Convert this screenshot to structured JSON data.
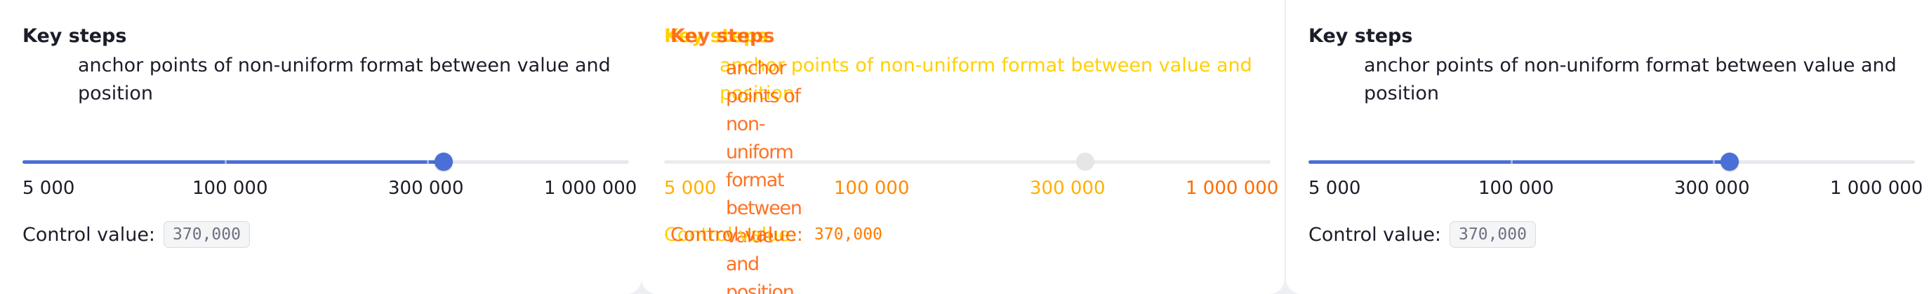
{
  "panels": [
    {
      "title": "Key steps",
      "description": "anchor points of non-uniform format between value and position",
      "marks": [
        "5 000",
        "100 000",
        "300 000",
        "1 000 000"
      ],
      "control_label": "Control value:",
      "control_value": "370,000",
      "slider_fraction": 0.695,
      "state": "normal"
    },
    {
      "title": "Key steps",
      "description": "anchor points of non-uniform format between value and position",
      "marks": [
        "5 000",
        "100 000",
        "300 000",
        "1 000 000"
      ],
      "control_label": "Control value:",
      "control_value": "370,000",
      "slider_fraction": 0.695,
      "state": "glitched"
    },
    {
      "title": "Key steps",
      "description": "anchor points of non-uniform format between value and position",
      "marks": [
        "5 000",
        "100 000",
        "300 000",
        "1 000 000"
      ],
      "control_label": "Control value:",
      "control_value": "370,000",
      "slider_fraction": 0.695,
      "state": "normal"
    }
  ],
  "colors": {
    "accent": "#4a6fd6",
    "text": "#1b1d29",
    "track": "#e8e9ee",
    "glitch_yellow": "#ffd000",
    "glitch_orange": "#ff5a00"
  }
}
